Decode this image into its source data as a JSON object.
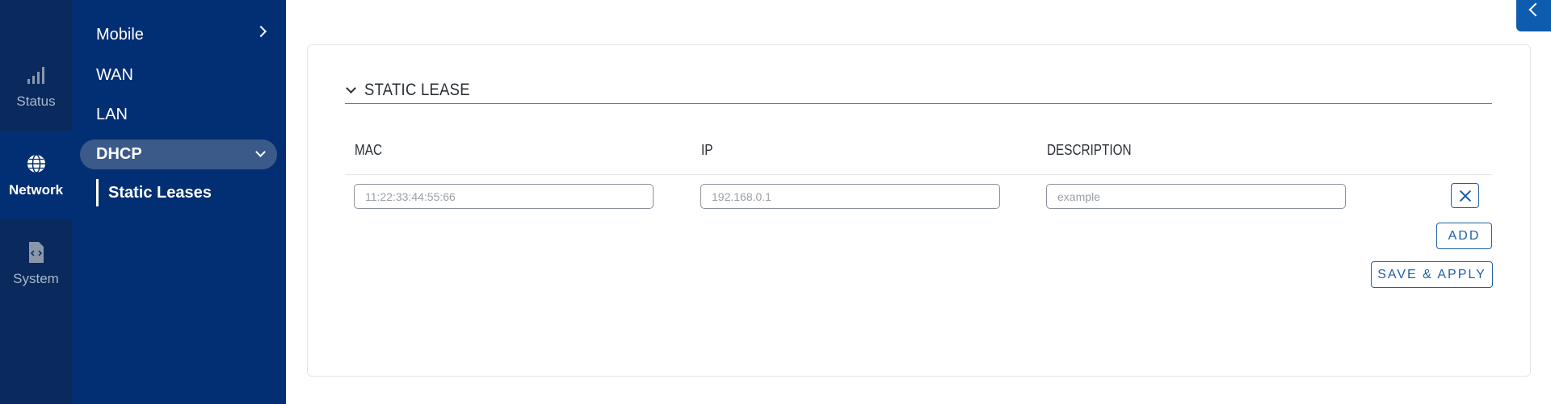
{
  "rail": {
    "items": [
      {
        "label": "Status",
        "icon": "signal-icon"
      },
      {
        "label": "Network",
        "icon": "globe-icon"
      },
      {
        "label": "System",
        "icon": "file-code-icon"
      }
    ]
  },
  "subnav": {
    "mobile": "Mobile",
    "wan": "WAN",
    "lan": "LAN",
    "dhcp": "DHCP",
    "static_leases": "Static Leases"
  },
  "section": {
    "title": "STATIC LEASE"
  },
  "table": {
    "headers": [
      "MAC",
      "IP",
      "DESCRIPTION"
    ],
    "row": {
      "mac_placeholder": "11:22:33:44:55:66",
      "ip_placeholder": "192.168.0.1",
      "description_placeholder": "example"
    }
  },
  "buttons": {
    "add": "ADD",
    "save_apply": "SAVE & APPLY"
  },
  "colors": {
    "rail_bg": "#0a2a5e",
    "subnav_bg": "#022f73",
    "accent": "#1f5fa8"
  }
}
